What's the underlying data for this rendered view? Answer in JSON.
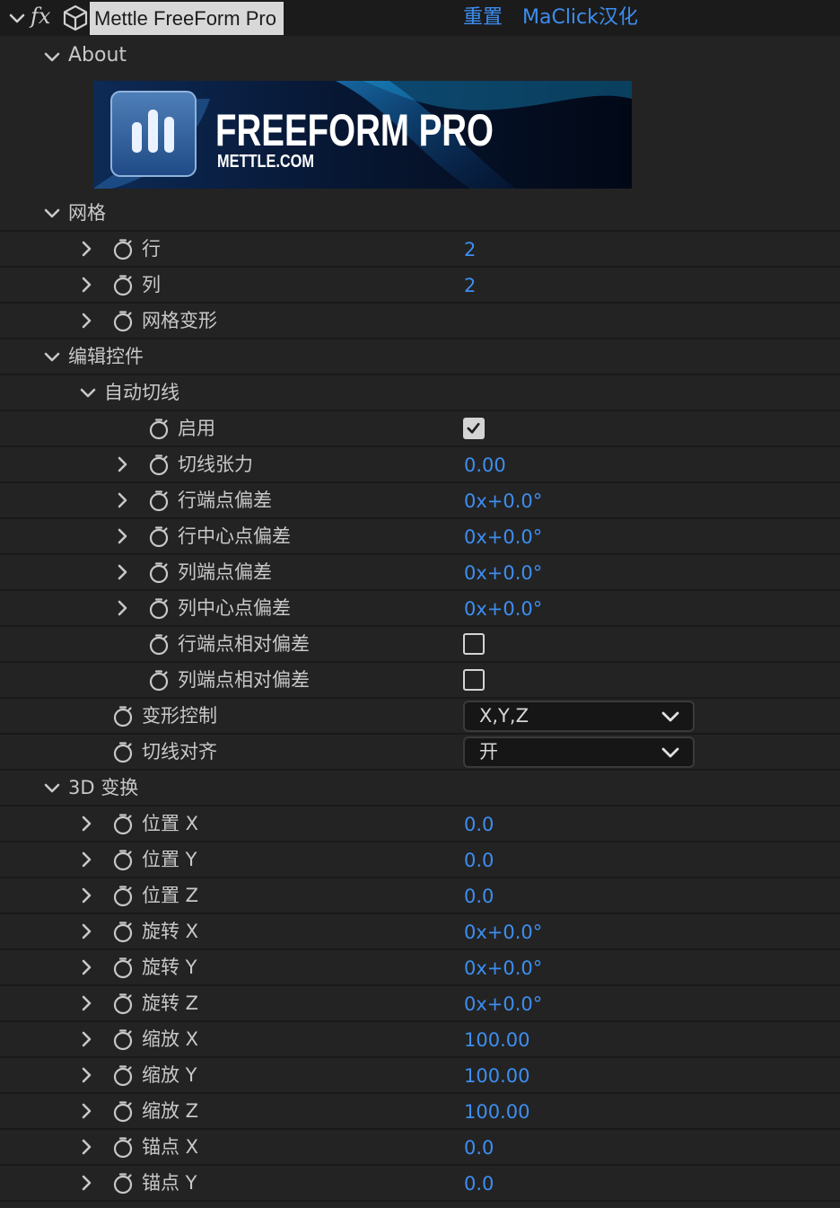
{
  "header": {
    "title": "Mettle FreeForm Pro",
    "fx_label": "fx",
    "reset_link": "重置",
    "credit_link": "MaClick汉化"
  },
  "about": {
    "label": "About"
  },
  "banner": {
    "title": "FREEFORM PRO",
    "subtitle": "METTLE.COM"
  },
  "rows": [
    {
      "label": "网格",
      "kind": "section-expanded"
    },
    {
      "label": "行",
      "kind": "value",
      "value": "2"
    },
    {
      "label": "列",
      "kind": "value",
      "value": "2"
    },
    {
      "label": "网格变形",
      "kind": "group"
    },
    {
      "label": "编辑控件",
      "kind": "section-expanded"
    },
    {
      "label": "自动切线",
      "kind": "subsection-expanded"
    },
    {
      "label": "启用",
      "kind": "checkbox",
      "checked": true
    },
    {
      "label": "切线张力",
      "kind": "value",
      "value": "0.00"
    },
    {
      "label": "行端点偏差",
      "kind": "value",
      "value": "0x+0.0°"
    },
    {
      "label": "行中心点偏差",
      "kind": "value",
      "value": "0x+0.0°"
    },
    {
      "label": "列端点偏差",
      "kind": "value",
      "value": "0x+0.0°"
    },
    {
      "label": "列中心点偏差",
      "kind": "value",
      "value": "0x+0.0°"
    },
    {
      "label": "行端点相对偏差",
      "kind": "checkbox",
      "checked": false
    },
    {
      "label": "列端点相对偏差",
      "kind": "checkbox",
      "checked": false
    },
    {
      "label": "变形控制",
      "kind": "select",
      "value": "X,Y,Z"
    },
    {
      "label": "切线对齐",
      "kind": "select",
      "value": "开"
    },
    {
      "label": "3D 变换",
      "kind": "section-expanded"
    },
    {
      "label": "位置 X",
      "kind": "value",
      "value": "0.0"
    },
    {
      "label": "位置 Y",
      "kind": "value",
      "value": "0.0"
    },
    {
      "label": "位置 Z",
      "kind": "value",
      "value": "0.0"
    },
    {
      "label": "旋转 X",
      "kind": "value",
      "value": "0x+0.0°"
    },
    {
      "label": "旋转 Y",
      "kind": "value",
      "value": "0x+0.0°"
    },
    {
      "label": "旋转 Z",
      "kind": "value",
      "value": "0x+0.0°"
    },
    {
      "label": "缩放 X",
      "kind": "value",
      "value": "100.00"
    },
    {
      "label": "缩放 Y",
      "kind": "value",
      "value": "100.00"
    },
    {
      "label": "缩放 Z",
      "kind": "value",
      "value": "100.00"
    },
    {
      "label": "锚点 X",
      "kind": "value",
      "value": "0.0"
    },
    {
      "label": "锚点 Y",
      "kind": "value",
      "value": "0.0"
    }
  ],
  "colors": {
    "background": "#232323",
    "header_background": "#1b1b1b",
    "value_blue": "#3d8ef0",
    "label_gray": "#c8c8c8"
  },
  "icons": {
    "toggle": "chevron-down-icon",
    "effect": "fx-icon",
    "plugin": "cube-icon",
    "expand_collapsed": "chevron-right-icon",
    "expand_open": "chevron-down-icon",
    "keyframe": "stopwatch-icon",
    "dropdown": "chevron-down-icon"
  }
}
